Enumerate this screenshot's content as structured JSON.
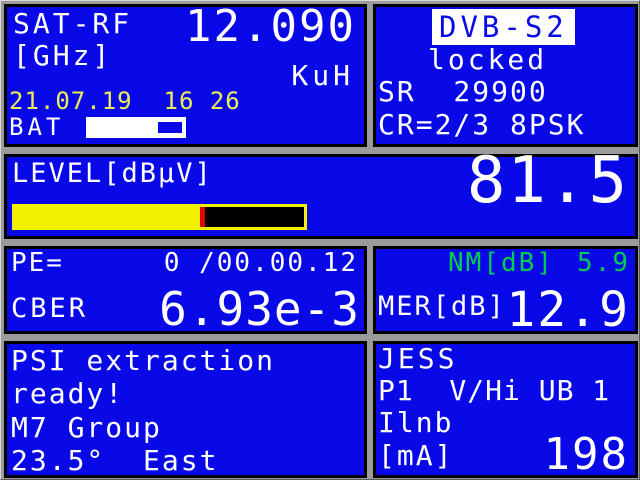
{
  "colors": {
    "panel_blue": "#0909e8",
    "frame_gray": "#9b9b9b",
    "text_white": "#ffffff",
    "text_yellow": "#eded55",
    "bar_yellow": "#f2f200",
    "bar_marker_red": "#e00000",
    "bar_empty_black": "#000000",
    "nm_green": "#00cc4d"
  },
  "sat_rf": {
    "label": "SAT-RF",
    "unit": "[GHz]",
    "frequency": "12.090",
    "band": "KuH",
    "datetime": "21.07.19  16 26",
    "battery_label": "BAT",
    "battery_marker_left_pct": 72,
    "battery_marker_width_pct": 24
  },
  "demod": {
    "standard": "DVB-S2",
    "lock_status": "locked",
    "symbol_rate": "SR  29900",
    "code_rate": "CR=2/3 8PSK"
  },
  "level": {
    "label": "LEVEL[dBµV]",
    "value": "81.5",
    "bar_fill_pct": 64
  },
  "errors": {
    "pe_label": "PE=",
    "pe_value": "0 /00.00.12",
    "cber_label": "CBER",
    "cber_value": "6.93e-3"
  },
  "quality": {
    "nm_label": "NM[dB]",
    "nm_value": "5.9",
    "mer_label": "MER[dB]",
    "mer_value": "12.9"
  },
  "psi": {
    "lines": [
      "PSI extraction",
      "ready!",
      "M7 Group",
      "23.5°  East"
    ]
  },
  "lnb": {
    "protocol": "JESS",
    "config": "P1  V/Hi UB 1",
    "current_label": "Ilnb",
    "current_unit": "[mA]",
    "current_value": "198"
  }
}
